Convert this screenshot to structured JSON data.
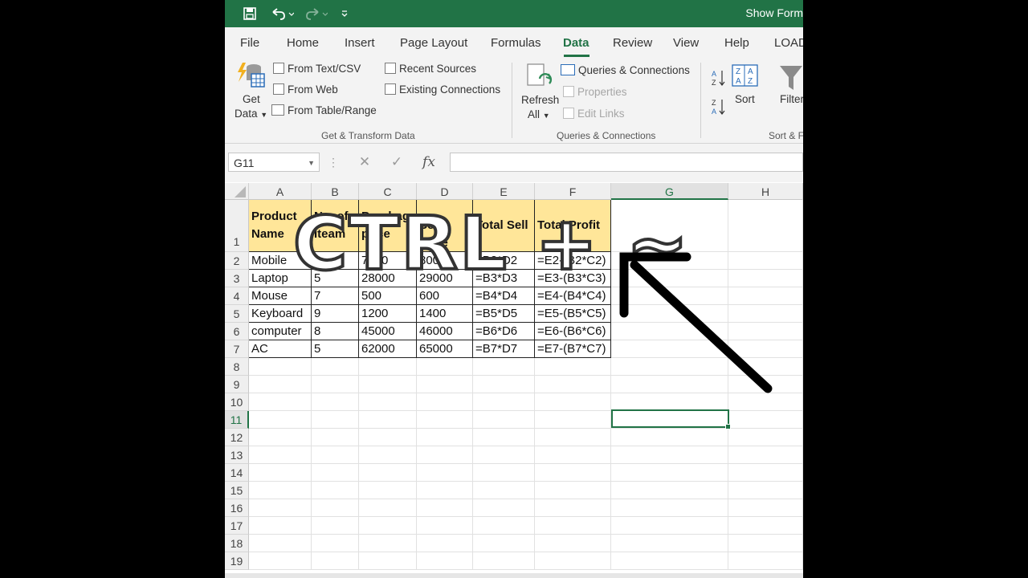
{
  "window": {
    "title": "Show Form"
  },
  "tabs": [
    "File",
    "Home",
    "Insert",
    "Page Layout",
    "Formulas",
    "Data",
    "Review",
    "View",
    "Help",
    "LOAD"
  ],
  "active_tab": "Data",
  "ribbon": {
    "get_data_1": "Get",
    "get_data_2": "Data",
    "from_text_csv": "From Text/CSV",
    "from_web": "From Web",
    "from_table_range": "From Table/Range",
    "recent_sources": "Recent Sources",
    "existing_connections": "Existing Connections",
    "group_get_transform": "Get & Transform Data",
    "refresh_1": "Refresh",
    "refresh_2": "All",
    "queries_connections": "Queries & Connections",
    "properties": "Properties",
    "edit_links": "Edit Links",
    "group_queries": "Queries & Connections",
    "sort": "Sort",
    "filter": "Filter",
    "group_sort": "Sort & F"
  },
  "formula_bar": {
    "name_box": "G11",
    "fx": "fx",
    "content": ""
  },
  "columns": [
    "A",
    "B",
    "C",
    "D",
    "E",
    "F",
    "G",
    "H"
  ],
  "rows": [
    "1",
    "2",
    "3",
    "4",
    "5",
    "6",
    "7",
    "8",
    "9",
    "10",
    "11",
    "12",
    "13",
    "14",
    "15",
    "16",
    "17",
    "18",
    "19"
  ],
  "table": {
    "headers": [
      [
        "Product",
        "Name"
      ],
      [
        "No. of",
        "Iteam"
      ],
      [
        "Purchage",
        "price"
      ],
      [
        "Sell price"
      ],
      [
        "Total Sell"
      ],
      [
        "Total Profit"
      ]
    ],
    "rows": [
      [
        "Mobile",
        "8",
        "7500",
        "8000",
        "=B2*D2",
        "=E2-(B2*C2)"
      ],
      [
        "Laptop",
        "5",
        "28000",
        "29000",
        "=B3*D3",
        "=E3-(B3*C3)"
      ],
      [
        "Mouse",
        "7",
        "500",
        "600",
        "=B4*D4",
        "=E4-(B4*C4)"
      ],
      [
        "Keyboard",
        "9",
        "1200",
        "1400",
        "=B5*D5",
        "=E5-(B5*C5)"
      ],
      [
        "computer",
        "8",
        "45000",
        "46000",
        "=B6*D6",
        "=E6-(B6*C6)"
      ],
      [
        "AC",
        "5",
        "62000",
        "65000",
        "=B7*D7",
        "=E7-(B7*C7)"
      ]
    ]
  },
  "selected_cell": "G11",
  "overlay_text": "CTRL + ~",
  "colors": {
    "excel_green": "#217346",
    "header_fill": "#ffe699"
  }
}
